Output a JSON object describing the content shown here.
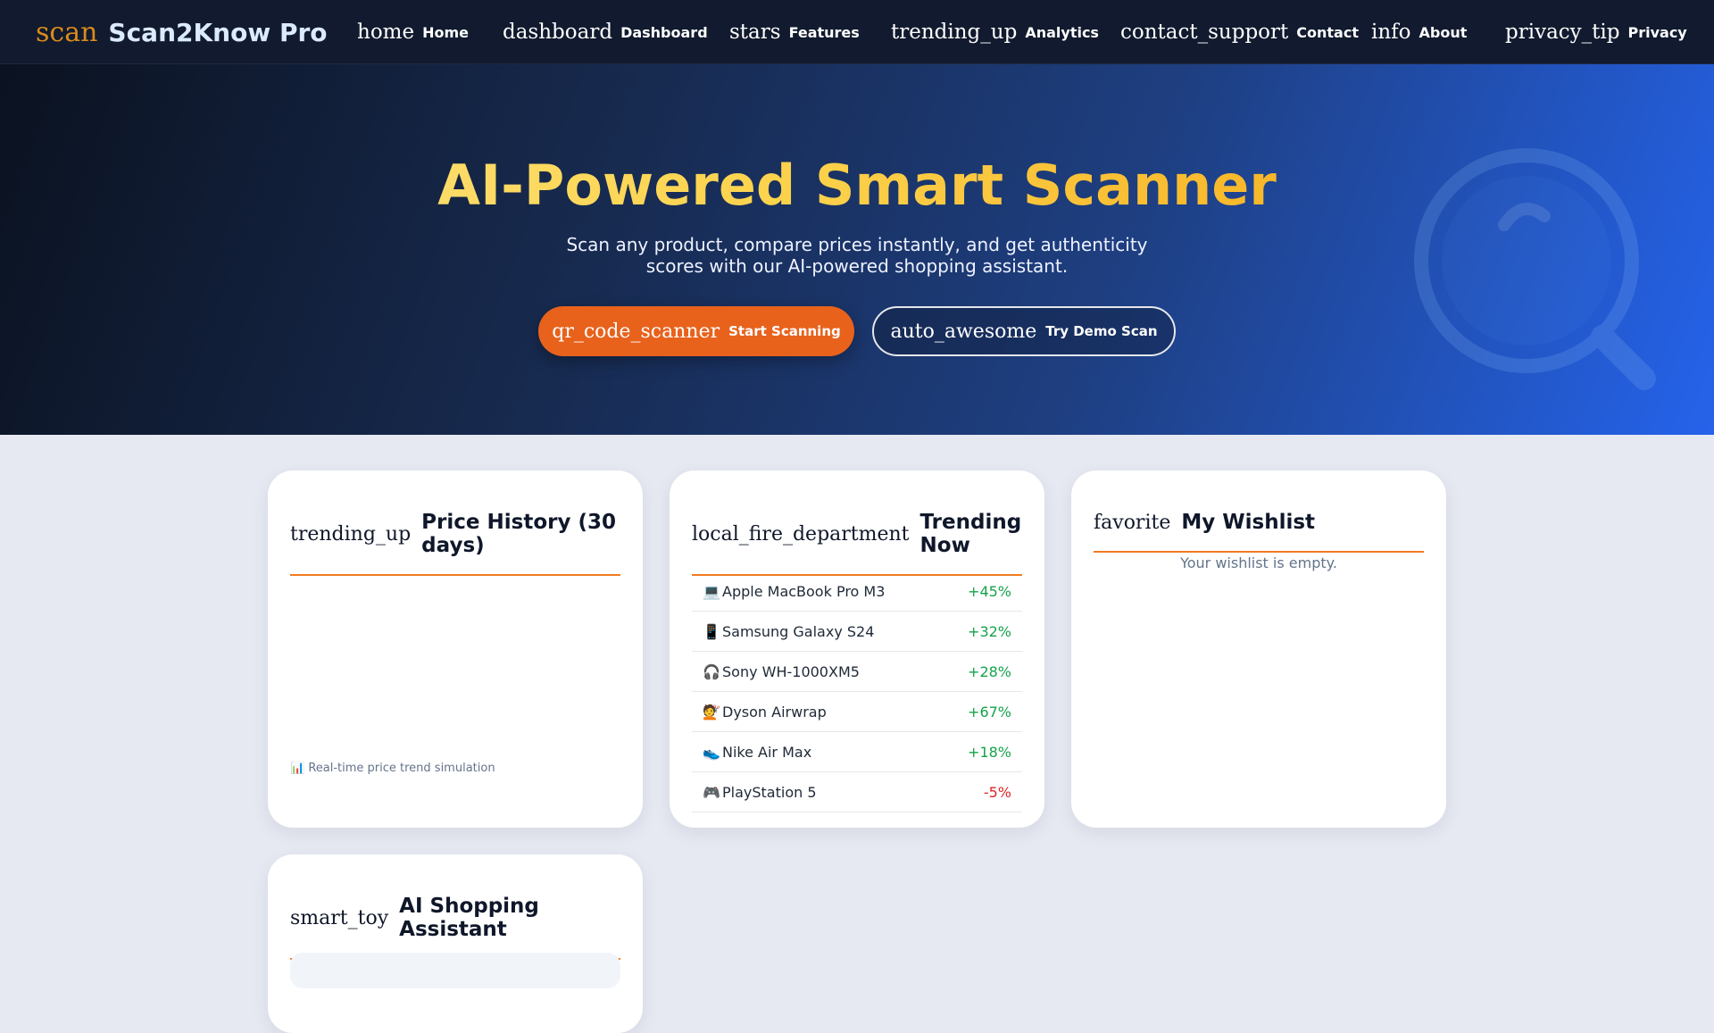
{
  "nav": {
    "brand_icon": "scan",
    "brand_name": "Scan2Know Pro",
    "items": [
      {
        "icon": "home",
        "label": "Home"
      },
      {
        "icon": "dashboard",
        "label": "Dashboard"
      },
      {
        "icon": "stars",
        "label": "Features"
      },
      {
        "icon": "trending_up",
        "label": "Analytics"
      },
      {
        "icon": "contact_support",
        "label": "Contact"
      },
      {
        "icon": "info",
        "label": "About"
      },
      {
        "icon": "privacy_tip",
        "label": "Privacy"
      }
    ]
  },
  "hero": {
    "title": "AI-Powered Smart Scanner",
    "subtitle": "Scan any product, compare prices instantly, and get authenticity scores with our AI-powered shopping assistant.",
    "primary_button": {
      "icon": "qr_code_scanner",
      "label": "Start Scanning"
    },
    "secondary_button": {
      "icon": "auto_awesome",
      "label": "Try Demo Scan"
    }
  },
  "price_history": {
    "icon": "trending_up",
    "title": "Price History (30 days)",
    "note": "📊 Real-time price trend simulation"
  },
  "trending": {
    "icon": "local_fire_department",
    "title": "Trending Now",
    "items": [
      {
        "emoji": "💻",
        "name": "Apple MacBook Pro M3",
        "change": "+45%",
        "direction": "up"
      },
      {
        "emoji": "📱",
        "name": "Samsung Galaxy S24",
        "change": "+32%",
        "direction": "up"
      },
      {
        "emoji": "🎧",
        "name": "Sony WH-1000XM5",
        "change": "+28%",
        "direction": "up"
      },
      {
        "emoji": "💇",
        "name": "Dyson Airwrap",
        "change": "+67%",
        "direction": "up"
      },
      {
        "emoji": "👟",
        "name": "Nike Air Max",
        "change": "+18%",
        "direction": "up"
      },
      {
        "emoji": "🎮",
        "name": "PlayStation 5",
        "change": "-5%",
        "direction": "down"
      }
    ]
  },
  "wishlist": {
    "icon": "favorite",
    "title": "My Wishlist",
    "empty_text": "Your wishlist is empty."
  },
  "assistant": {
    "icon": "smart_toy",
    "title": "AI Shopping Assistant"
  },
  "colors": {
    "nav_bg": "#111a2e",
    "accent_orange": "#e8621c",
    "title_gold": "#fcd34d",
    "positive": "#16a34a",
    "negative": "#dc2626"
  }
}
